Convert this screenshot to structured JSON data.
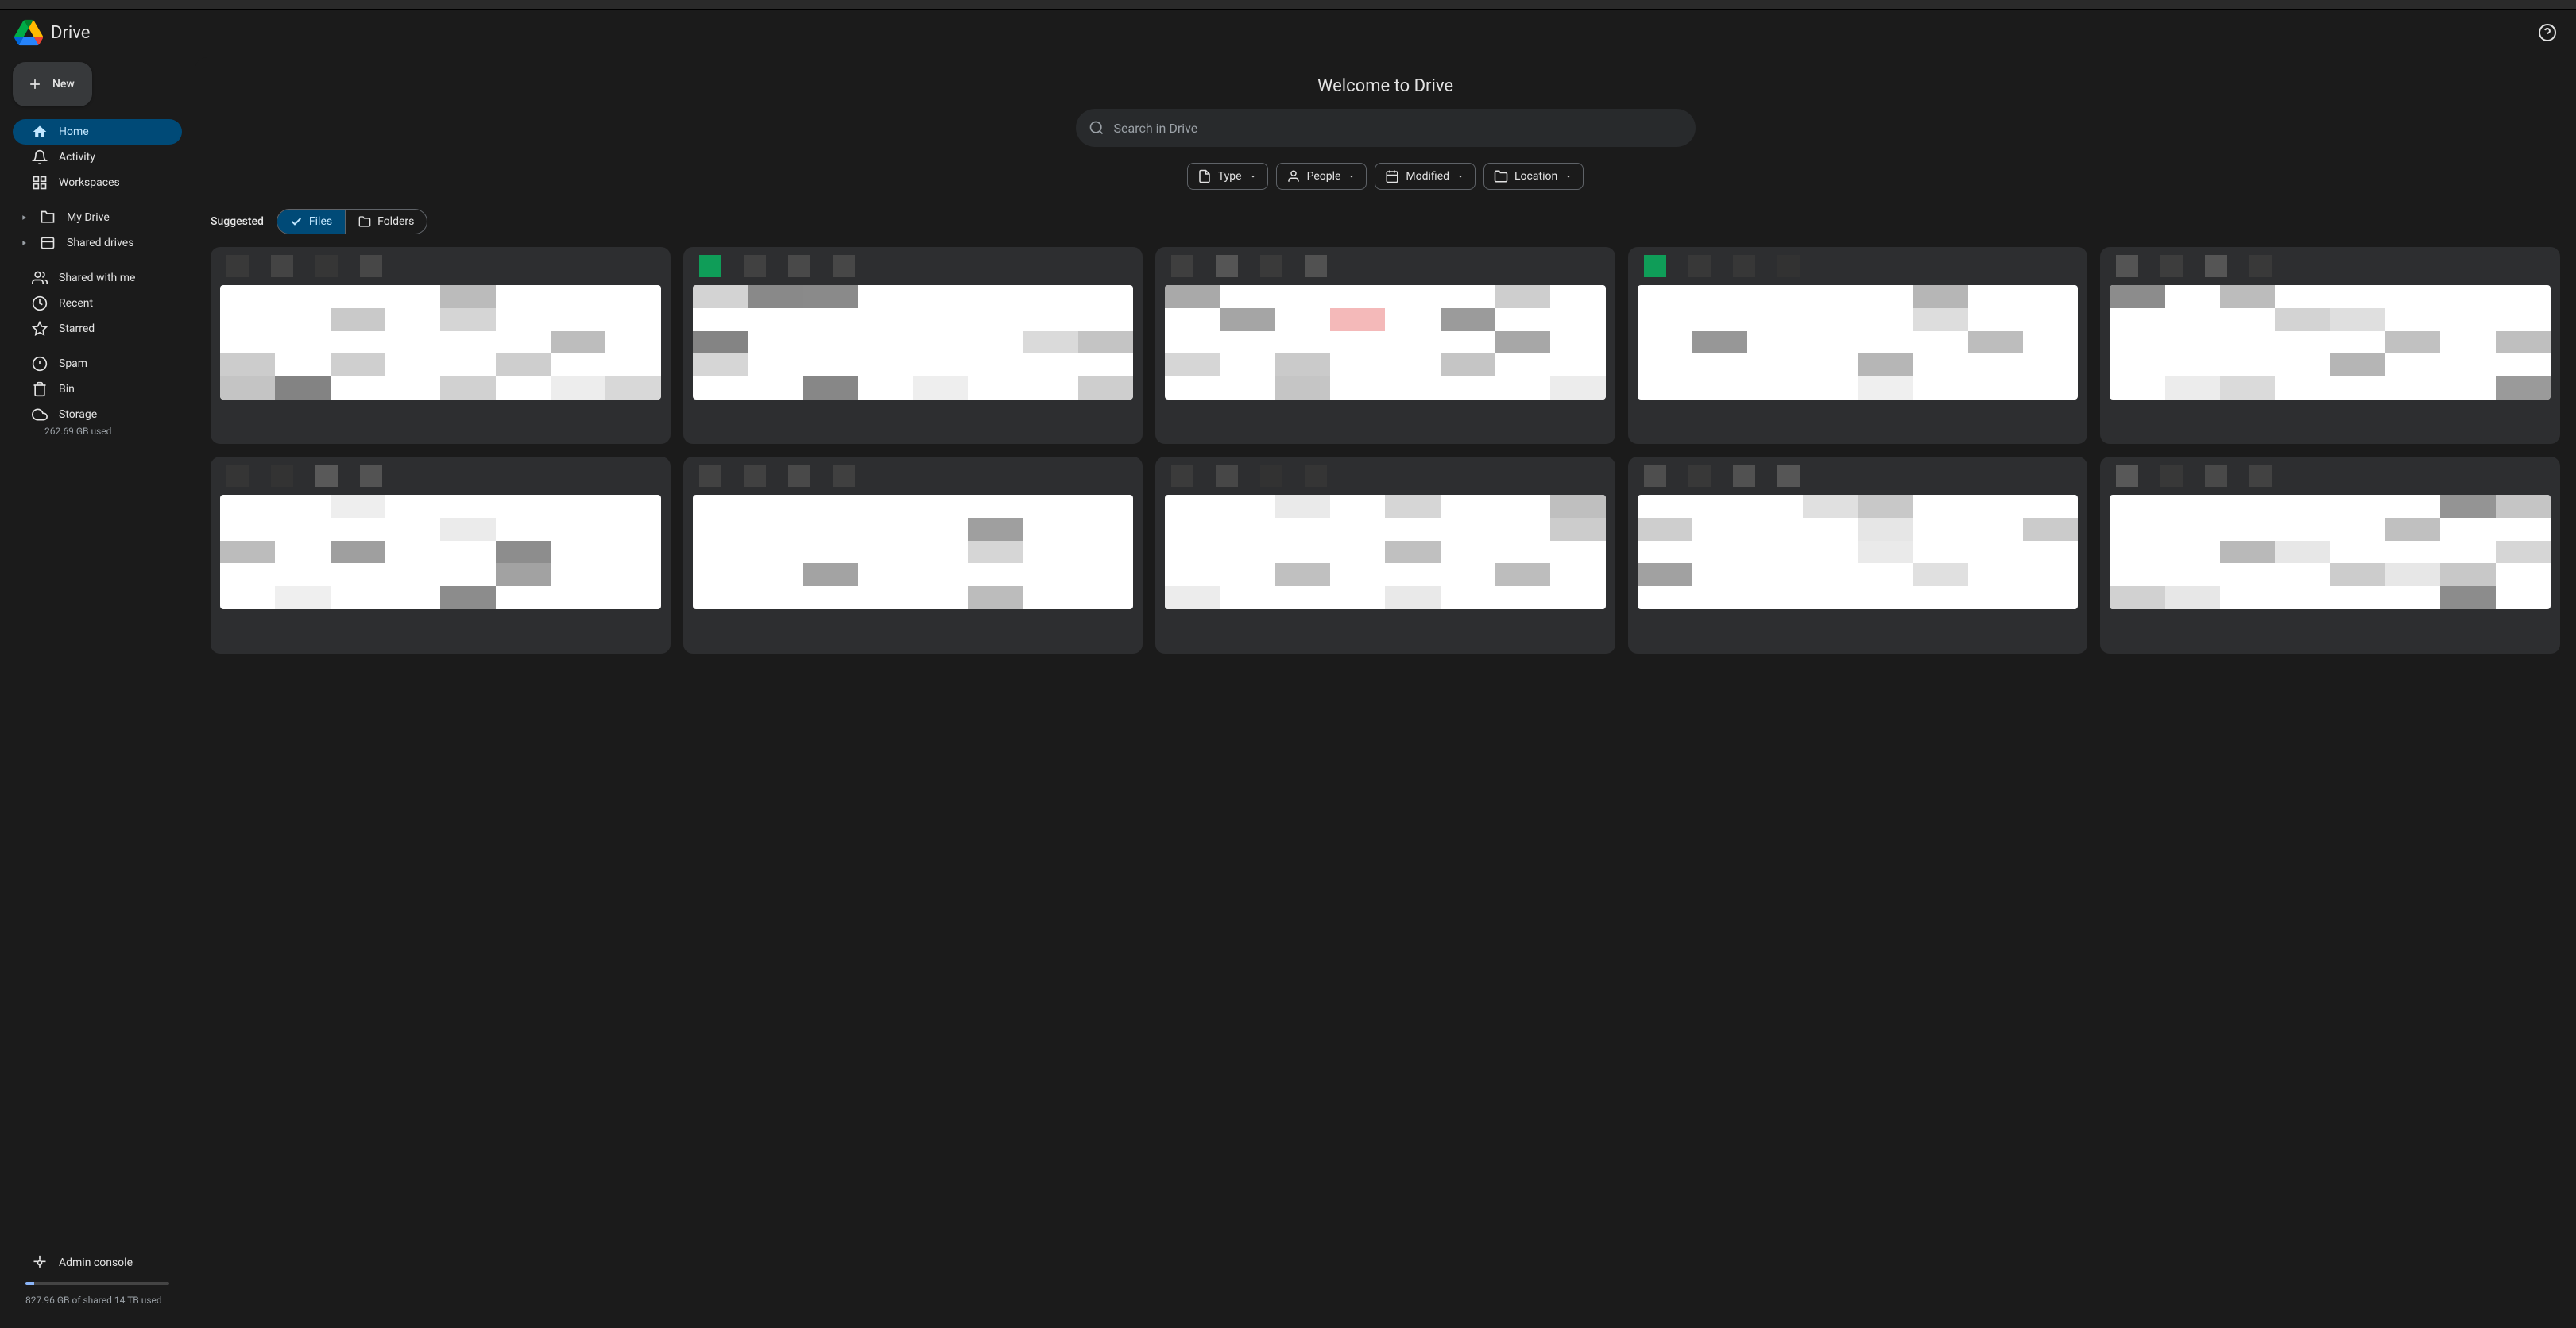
{
  "app": {
    "name": "Drive"
  },
  "header": {
    "welcome": "Welcome to Drive"
  },
  "sidebar": {
    "new_label": "New",
    "nav": {
      "home": "Home",
      "activity": "Activity",
      "workspaces": "Workspaces",
      "my_drive": "My Drive",
      "shared_drives": "Shared drives",
      "shared_with_me": "Shared with me",
      "recent": "Recent",
      "starred": "Starred",
      "spam": "Spam",
      "bin": "Bin",
      "storage": "Storage"
    },
    "storage_used": "262.69 GB used",
    "admin_console": "Admin console",
    "shared_storage": "827.96 GB of shared 14 TB used"
  },
  "search": {
    "placeholder": "Search in Drive"
  },
  "filters": {
    "type": "Type",
    "people": "People",
    "modified": "Modified",
    "location": "Location"
  },
  "suggested": {
    "label": "Suggested",
    "files": "Files",
    "folders": "Folders"
  }
}
